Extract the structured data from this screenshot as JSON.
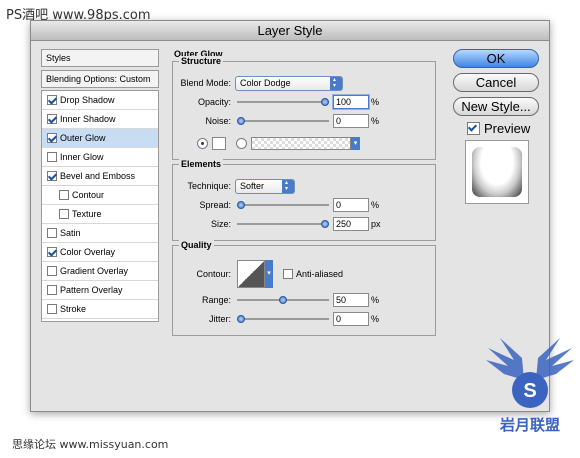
{
  "watermark": {
    "top": "PS酒吧 www.98ps.com",
    "bottom": "思缘论坛 www.missyuan.com",
    "logo_text": "岩月联盟"
  },
  "window": {
    "title": "Layer Style"
  },
  "left_panel": {
    "styles_label": "Styles",
    "blending_label": "Blending Options: Custom",
    "items": [
      {
        "label": "Drop Shadow",
        "checked": true
      },
      {
        "label": "Inner Shadow",
        "checked": true
      },
      {
        "label": "Outer Glow",
        "checked": true,
        "selected": true
      },
      {
        "label": "Inner Glow",
        "checked": false
      },
      {
        "label": "Bevel and Emboss",
        "checked": true
      },
      {
        "label": "Contour",
        "checked": false,
        "sub": true
      },
      {
        "label": "Texture",
        "checked": false,
        "sub": true
      },
      {
        "label": "Satin",
        "checked": false
      },
      {
        "label": "Color Overlay",
        "checked": true
      },
      {
        "label": "Gradient Overlay",
        "checked": false
      },
      {
        "label": "Pattern Overlay",
        "checked": false
      },
      {
        "label": "Stroke",
        "checked": false
      }
    ]
  },
  "outer_glow": {
    "section_title": "Outer Glow",
    "structure": {
      "title": "Structure",
      "blend_mode_label": "Blend Mode:",
      "blend_mode_value": "Color Dodge",
      "opacity_label": "Opacity:",
      "opacity_value": "100",
      "opacity_level": 1.0,
      "noise_label": "Noise:",
      "noise_value": "0",
      "noise_level": 0,
      "percent": "%"
    },
    "elements": {
      "title": "Elements",
      "technique_label": "Technique:",
      "technique_value": "Softer",
      "spread_label": "Spread:",
      "spread_value": "0",
      "spread_level": 0,
      "size_label": "Size:",
      "size_value": "250",
      "size_level": 1.0,
      "percent": "%",
      "px": "px"
    },
    "quality": {
      "title": "Quality",
      "contour_label": "Contour:",
      "anti_aliased_label": "Anti-aliased",
      "range_label": "Range:",
      "range_value": "50",
      "range_level": 0.5,
      "jitter_label": "Jitter:",
      "jitter_value": "0",
      "jitter_level": 0,
      "percent": "%"
    }
  },
  "buttons": {
    "ok": "OK",
    "cancel": "Cancel",
    "new_style": "New Style...",
    "preview_label": "Preview"
  },
  "colors": {
    "accent": "#4a7bc8",
    "selection": "#c8dcf3",
    "logo": "#3b64c0"
  }
}
